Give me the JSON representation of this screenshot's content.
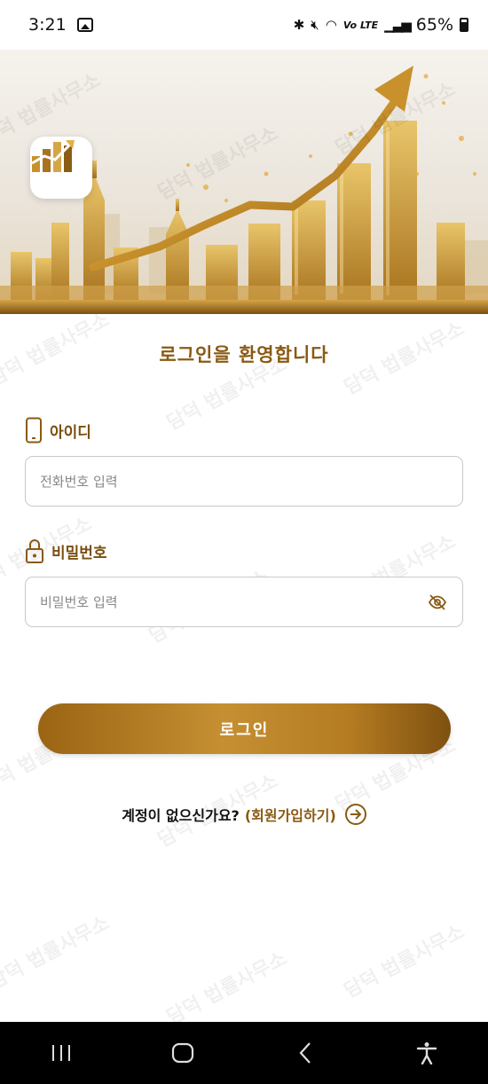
{
  "status_bar": {
    "time": "3:21",
    "network": "Vo LTE",
    "battery": "65%"
  },
  "watermark_text": "담덕 법률사무소",
  "login": {
    "welcome": "로그인을 환영합니다",
    "id_label": "아이디",
    "id_placeholder": "전화번호 입력",
    "password_label": "비밀번호",
    "password_placeholder": "비밀번호 입력",
    "login_button": "로그인",
    "signup_question": "계정이 없으신가요?",
    "signup_link": "(회원가입하기)"
  },
  "colors": {
    "accent": "#8a5a12",
    "button_gold": "#b57c22"
  },
  "icons": {
    "phone": "phone-icon",
    "lock": "lock-icon",
    "eye": "eye-off-icon",
    "arrow": "arrow-right-circle-icon"
  }
}
